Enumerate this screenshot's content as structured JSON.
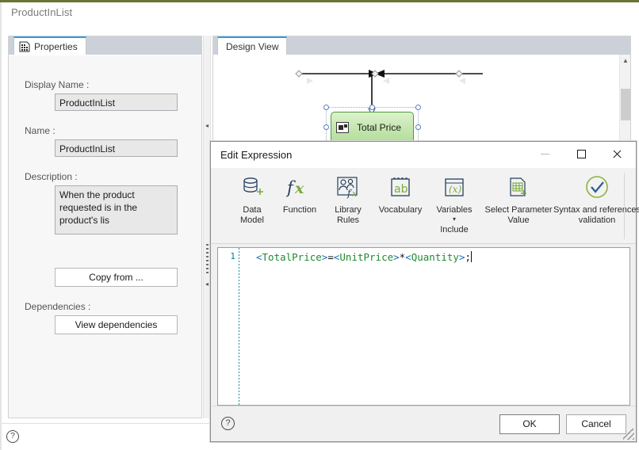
{
  "app": {
    "title": "ProductInList",
    "help_icon": "help-circle-icon",
    "accent_top_color": "#6b7333"
  },
  "properties_panel": {
    "tab_label": "Properties",
    "tab_icon": "properties-grid-icon",
    "fields": [
      {
        "label": "Display Name :",
        "value": "ProductInList"
      },
      {
        "label": "Name :",
        "value": "ProductInList"
      },
      {
        "label": "Description :",
        "value": "When the product requested is in the product's lis"
      }
    ],
    "copy_from_label": "Copy from ...",
    "dependencies_label": "Dependencies :",
    "view_dependencies_label": "View dependencies"
  },
  "splitter": {
    "collapse_icon": "collapse-left-arrow-icon",
    "grip_icon": "splitter-grip-icon"
  },
  "design_panel": {
    "tab_label": "Design View",
    "node_label": "Total Price",
    "node_icon": "rule-node-icon",
    "node_fill": "#c6e7b0",
    "node_border": "#4f9b35",
    "scroll_up_icon": "chevron-up-icon"
  },
  "dialog": {
    "title": "Edit Expression",
    "window_buttons": [
      {
        "name": "minimize-button",
        "icon": "minimize-icon"
      },
      {
        "name": "maximize-button",
        "icon": "maximize-icon"
      },
      {
        "name": "close-button",
        "icon": "close-icon"
      }
    ],
    "ribbon": [
      {
        "label": "Data\nModel",
        "icon": "database-add-icon"
      },
      {
        "label": "Function",
        "icon": "fx-icon"
      },
      {
        "label": "Library\nRules",
        "icon": "library-rules-icon"
      },
      {
        "label": "Vocabulary",
        "icon": "vocabulary-ab-icon"
      },
      {
        "label": "Variables",
        "icon": "variables-x-icon",
        "caret": "▾",
        "sub_label": "Include"
      },
      {
        "label": "Select Parameter\nValue",
        "icon": "select-parameter-value-icon"
      },
      {
        "label": "Syntax and references\nvalidation",
        "icon": "validation-check-icon"
      }
    ],
    "editor": {
      "line_number": "1",
      "expression": "<TotalPrice>=<UnitPrice>*<Quantity>;",
      "tokens": [
        {
          "t": "<",
          "k": "br"
        },
        {
          "t": "TotalPrice",
          "k": "id"
        },
        {
          "t": ">",
          "k": "br"
        },
        {
          "t": "=",
          "k": "op"
        },
        {
          "t": "<",
          "k": "br"
        },
        {
          "t": "UnitPrice",
          "k": "id"
        },
        {
          "t": ">",
          "k": "br"
        },
        {
          "t": "*",
          "k": "op"
        },
        {
          "t": "<",
          "k": "br"
        },
        {
          "t": "Quantity",
          "k": "id"
        },
        {
          "t": ">",
          "k": "br"
        },
        {
          "t": ";",
          "k": "op"
        }
      ],
      "bracket_color": "#1a6fb8",
      "identifier_color": "#1f8a2f",
      "gutter_color": "#0b7a8c"
    },
    "footer": {
      "help_icon": "help-circle-icon",
      "ok_label": "OK",
      "cancel_label": "Cancel"
    }
  }
}
